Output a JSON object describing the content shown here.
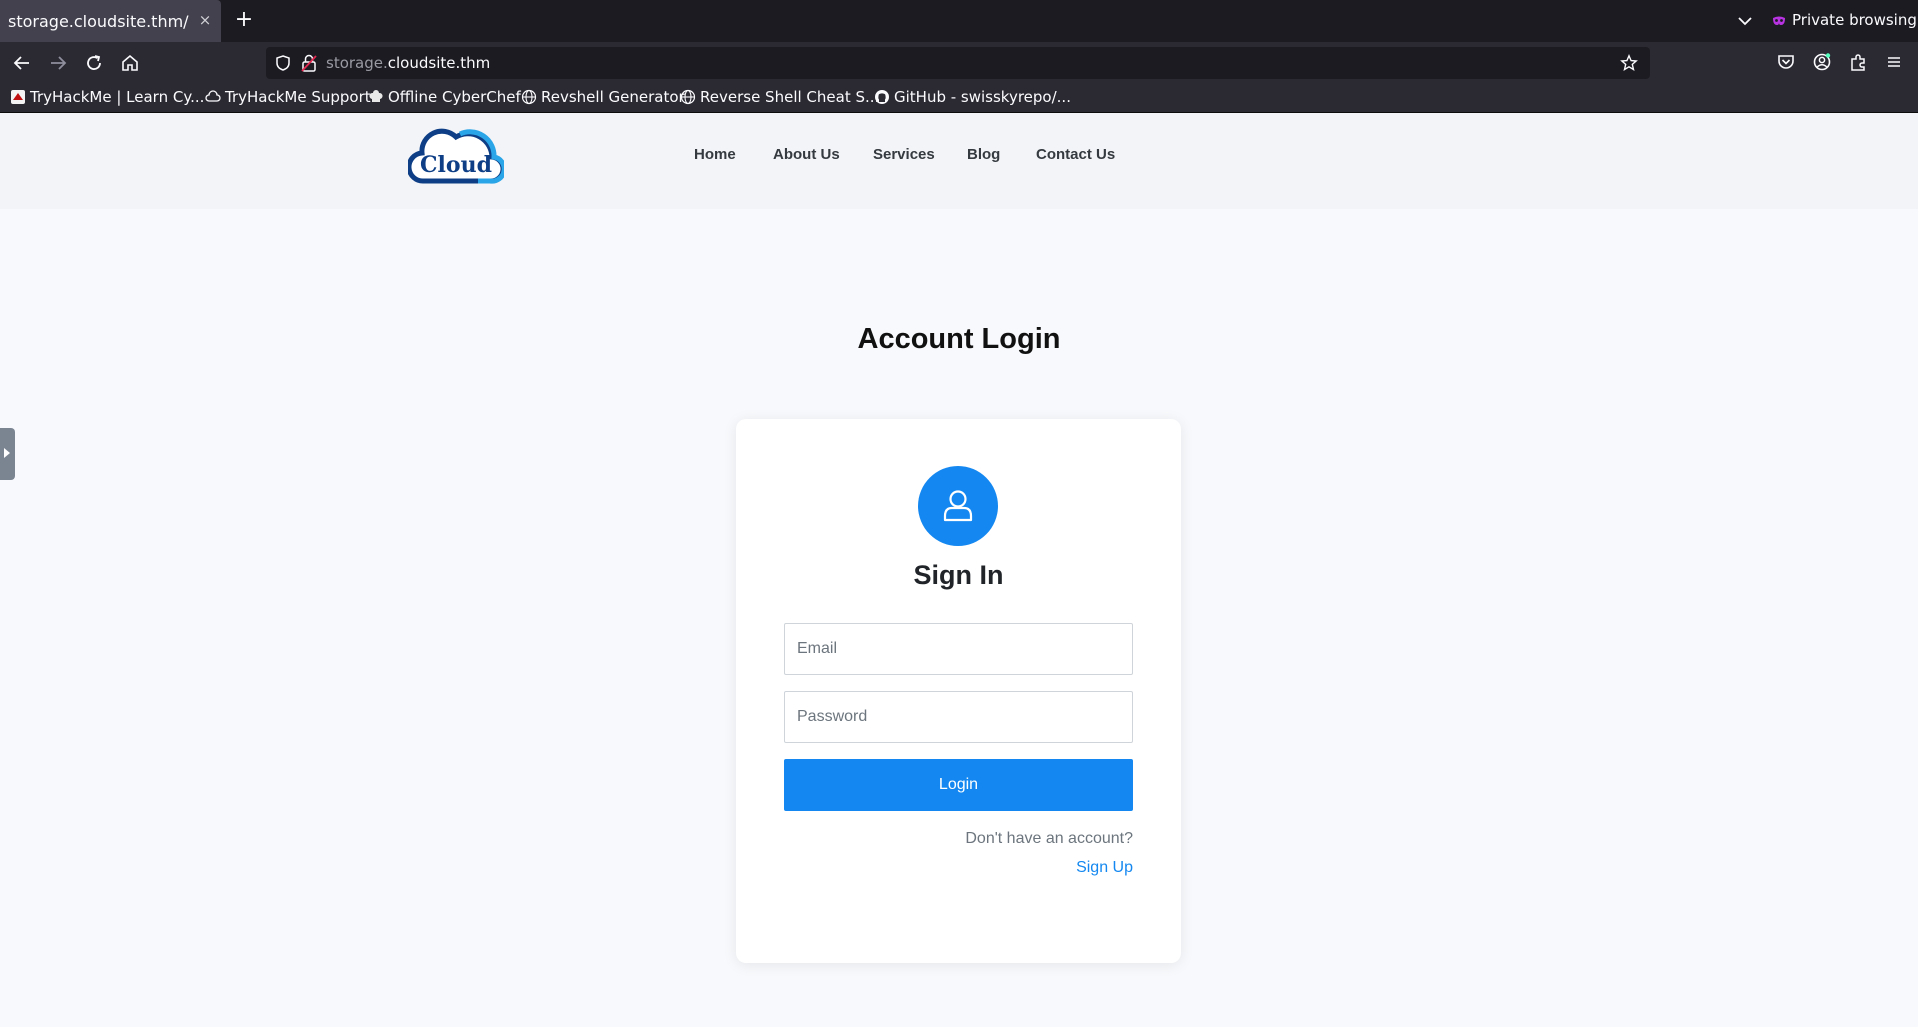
{
  "browser": {
    "tab_title": "storage.cloudsite.thm/",
    "tab_close_glyph": "×",
    "new_tab_glyph": "+",
    "private_label": "Private browsing",
    "url_subdomain": "storage.",
    "url_domain": "cloudsite.thm",
    "bookmarks": [
      {
        "label": "TryHackMe | Learn Cy...",
        "icon": "tryhackme-icon"
      },
      {
        "label": "TryHackMe Support",
        "icon": "cloud-icon"
      },
      {
        "label": "Offline CyberChef",
        "icon": "chef-hat-icon"
      },
      {
        "label": "Revshell Generator",
        "icon": "globe-icon"
      },
      {
        "label": "Reverse Shell Cheat S...",
        "icon": "globe-icon"
      },
      {
        "label": "GitHub - swisskyrepo/...",
        "icon": "github-icon"
      }
    ]
  },
  "site": {
    "logo_text": "Cloud",
    "nav": [
      "Home",
      "About Us",
      "Services",
      "Blog",
      "Contact Us"
    ],
    "page_title": "Account Login",
    "card": {
      "title": "Sign In",
      "email_placeholder": "Email",
      "password_placeholder": "Password",
      "login_label": "Login",
      "no_account_text": "Don't have an account?",
      "signup_label": "Sign Up"
    }
  },
  "colors": {
    "accent": "#1488f0",
    "logo_dark": "#0e3f86",
    "logo_light": "#2aa5e8",
    "chrome_dark": "#1c1b22",
    "chrome_mid": "#2b2a33"
  }
}
